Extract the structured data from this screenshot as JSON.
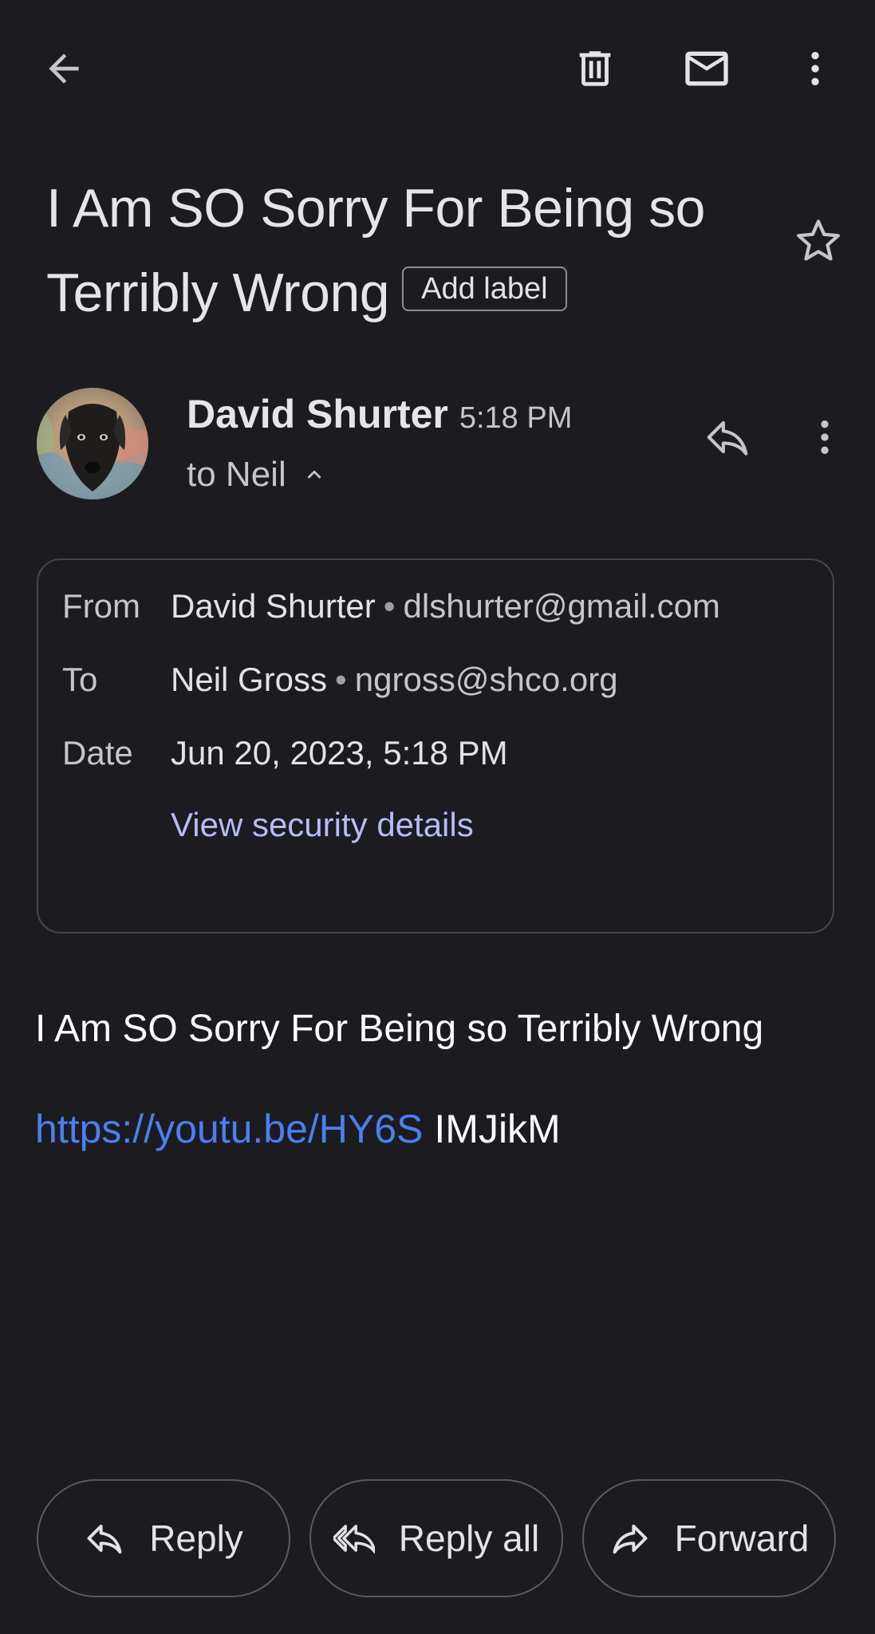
{
  "toolbar": {
    "back_icon": "arrow-back-icon",
    "delete_icon": "trash-icon",
    "mark_unread_icon": "mail-icon",
    "more_icon": "more-vert-icon"
  },
  "email": {
    "subject": "I Am SO Sorry For Being so Terribly Wrong",
    "add_label": "Add label",
    "star_icon": "star-outline-icon"
  },
  "sender": {
    "name": "David Shurter",
    "time": "5:18 PM",
    "to_line": "to Neil",
    "avatar": "avatar-photo-dog"
  },
  "details": {
    "from_label": "From",
    "from_name": "David Shurter",
    "from_email": "dlshurter@gmail.com",
    "to_label": "To",
    "to_name": "Neil Gross",
    "to_email": "ngross@shco.org",
    "date_label": "Date",
    "date_value": "Jun 20, 2023, 5:18 PM",
    "security_link": "View security details",
    "separator": "•"
  },
  "body": {
    "text": "I Am SO Sorry For Being so Terribly Wrong",
    "link": "https://youtu.be/HY6S",
    "link_tail": "IMJikM"
  },
  "actions": {
    "reply": "Reply",
    "reply_all": "Reply all",
    "forward": "Forward"
  },
  "colors": {
    "background": "#1c1b20",
    "link_blue": "#4b7ff0",
    "security_link": "#b6bcf5"
  }
}
